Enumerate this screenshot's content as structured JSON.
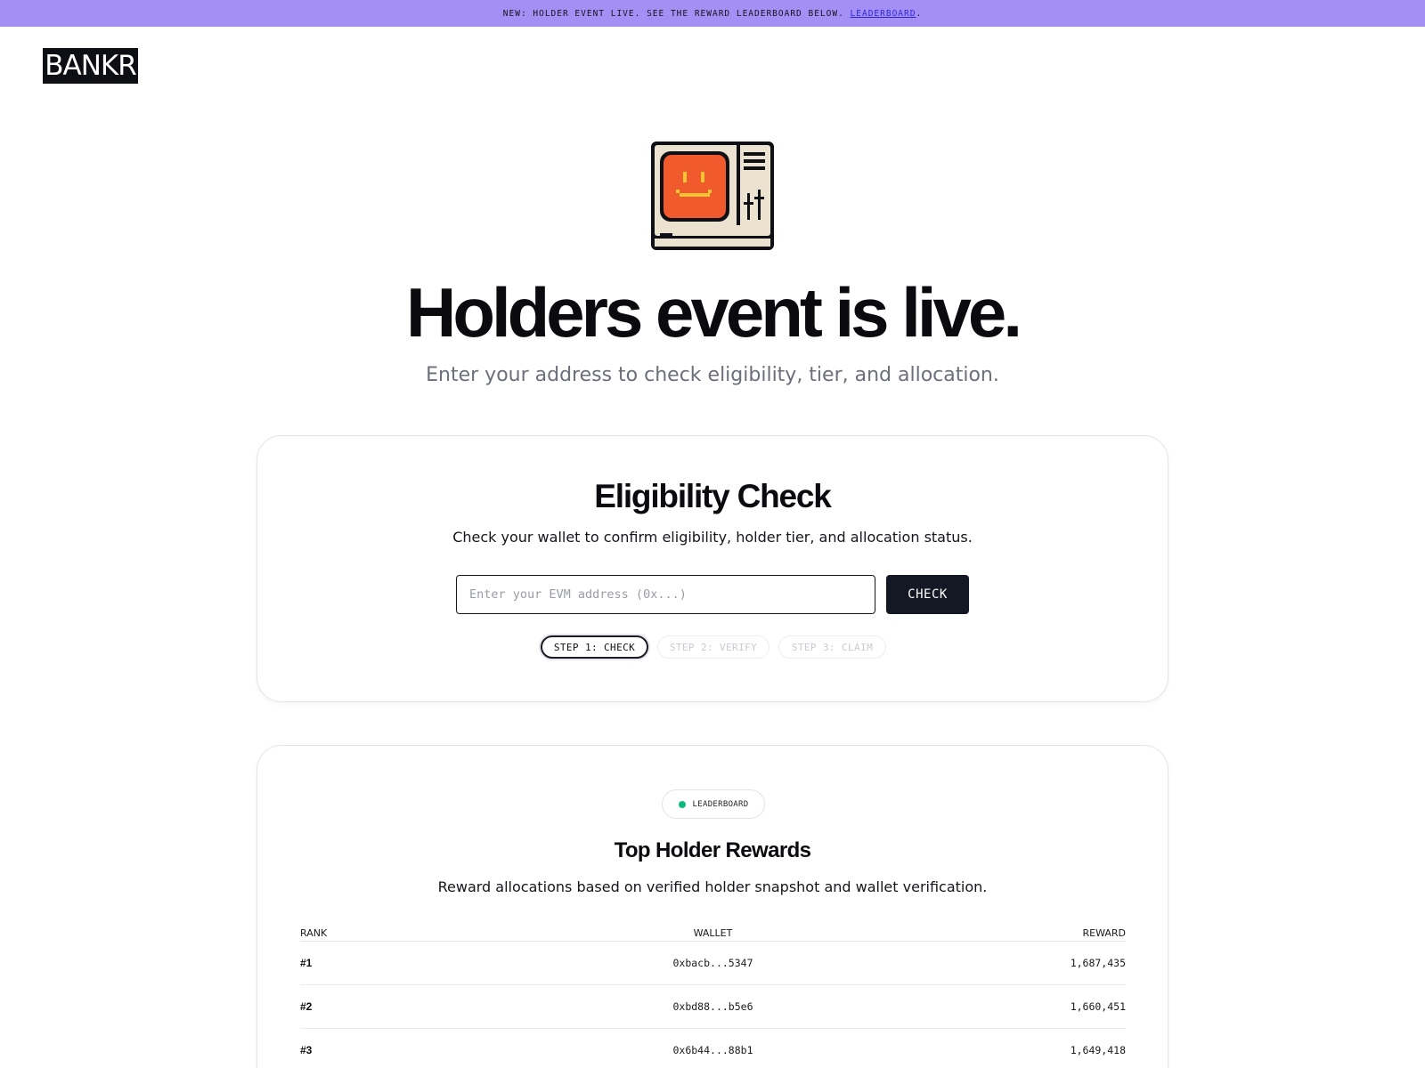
{
  "banner": {
    "text": "NEW: HOLDER EVENT LIVE. SEE THE REWARD LEADERBOARD BELOW.",
    "link_label": "LEADERBOARD",
    "trailing": "."
  },
  "logo": {
    "text": "BANKR"
  },
  "hero": {
    "icon": "retro-computer-smiley-icon",
    "title": "Holders event is live.",
    "subtitle": "Enter your address to check eligibility, tier, and allocation."
  },
  "eligibility": {
    "title": "Eligibility Check",
    "description": "Check your wallet to confirm eligibility, holder tier, and allocation status.",
    "input_value": "",
    "input_placeholder": "Enter your EVM address (0x...)",
    "button_label": "CHECK",
    "steps": [
      {
        "label": "STEP 1: CHECK",
        "active": true
      },
      {
        "label": "STEP 2: VERIFY",
        "active": false
      },
      {
        "label": "STEP 3: CLAIM",
        "active": false
      }
    ]
  },
  "leaderboard": {
    "badge": "LEADERBOARD",
    "badge_color": "#10b981",
    "title": "Top Holder Rewards",
    "description": "Reward allocations based on verified holder snapshot and wallet verification.",
    "columns": {
      "rank": "RANK",
      "wallet": "WALLET",
      "reward": "REWARD"
    },
    "rows": [
      {
        "rank": "#1",
        "wallet": "0xbacb...5347",
        "reward": "1,687,435"
      },
      {
        "rank": "#2",
        "wallet": "0xbd88...b5e6",
        "reward": "1,660,451"
      },
      {
        "rank": "#3",
        "wallet": "0x6b44...88b1",
        "reward": "1,649,418"
      }
    ]
  },
  "colors": {
    "banner_bg": "#a48ff5",
    "link": "#2c27d6",
    "dark": "#141824",
    "muted_text": "#6b6f7a",
    "icon_face": "#f05a2c",
    "icon_eyes": "#f5c630",
    "icon_body": "#ebe3cf"
  }
}
